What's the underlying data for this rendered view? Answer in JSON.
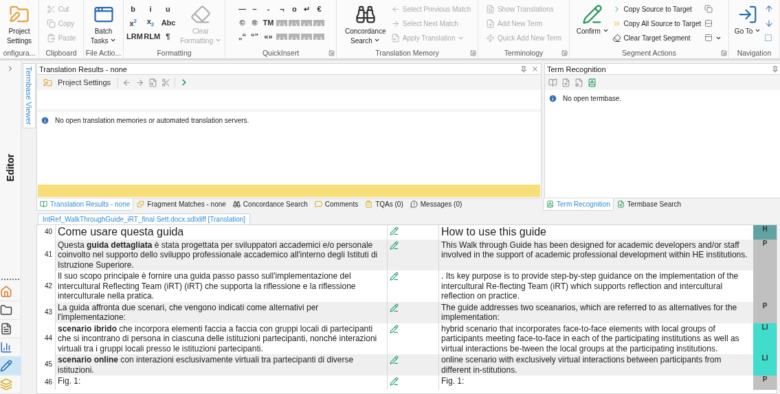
{
  "ribbon": {
    "groups": [
      {
        "label": "onfigura...",
        "launcher": false,
        "items": [
          {
            "kind": "large",
            "label": "Project Settings",
            "disabled": false,
            "dropdown": false
          }
        ]
      },
      {
        "label": "Clipboard",
        "launcher": false,
        "items": [
          {
            "kind": "small",
            "label": "Cut",
            "disabled": true,
            "dropdown": false
          },
          {
            "kind": "small",
            "label": "Copy",
            "disabled": true,
            "dropdown": false
          },
          {
            "kind": "small",
            "label": "Paste",
            "disabled": true,
            "dropdown": false
          }
        ]
      },
      {
        "label": "File Actio...",
        "launcher": false,
        "items": [
          {
            "kind": "large",
            "label": "Batch Tasks",
            "disabled": false,
            "dropdown": true
          }
        ]
      },
      {
        "label": "Formatting",
        "launcher": false,
        "items": [
          {
            "kind": "glyph",
            "label": "b"
          },
          {
            "kind": "glyph",
            "label": "i"
          },
          {
            "kind": "glyph",
            "label": "u"
          },
          {
            "kind": "glyph",
            "label": "x$^{2}$"
          },
          {
            "kind": "glyph",
            "label": "x$_{2}$"
          },
          {
            "kind": "glyph",
            "label": "Abc"
          },
          {
            "kind": "glyph",
            "label": "LRM"
          },
          {
            "kind": "glyph",
            "label": "RLM"
          },
          {
            "kind": "glyph",
            "label": "¶"
          },
          {
            "kind": "large",
            "label": "Clear Formatting",
            "disabled": true,
            "dropdown": true
          }
        ]
      },
      {
        "label": "QuickInsert",
        "launcher": true,
        "items": [
          {
            "kind": "glyph",
            "label": "—"
          },
          {
            "kind": "glyph",
            "label": "–"
          },
          {
            "kind": "glyph",
            "label": "-"
          },
          {
            "kind": "glyph",
            "label": "¬"
          },
          {
            "kind": "glyph",
            "label": "o"
          },
          {
            "kind": "glyph",
            "label": "↵"
          },
          {
            "kind": "glyph",
            "label": "€"
          },
          {
            "kind": "glyph",
            "label": "©"
          },
          {
            "kind": "glyph",
            "label": "®"
          },
          {
            "kind": "glyph",
            "label": "TM"
          },
          {
            "kind": "tag"
          },
          {
            "kind": "tag"
          },
          {
            "kind": "tag"
          },
          {
            "kind": "tag"
          },
          {
            "kind": "glyph",
            "label": "„“"
          },
          {
            "kind": "glyph",
            "label": "“”"
          },
          {
            "kind": "glyph",
            "label": "«»"
          },
          {
            "kind": "tag"
          },
          {
            "kind": "tag"
          },
          {
            "kind": "tag"
          },
          {
            "kind": "tag"
          }
        ]
      },
      {
        "label": "Translation Memory",
        "launcher": true,
        "items": [
          {
            "kind": "large",
            "label": "Concordance Search",
            "disabled": false,
            "dropdown": true
          },
          {
            "kind": "small",
            "label": "Select Previous Match",
            "disabled": true,
            "dropdown": false
          },
          {
            "kind": "small",
            "label": "Select Next Match",
            "disabled": true,
            "dropdown": false
          },
          {
            "kind": "small",
            "label": "Apply Translation",
            "disabled": true,
            "dropdown": true
          }
        ]
      },
      {
        "label": "Terminology",
        "launcher": true,
        "items": [
          {
            "kind": "small",
            "label": "Show Translations",
            "disabled": true,
            "dropdown": false
          },
          {
            "kind": "small",
            "label": "Add New Term",
            "disabled": true,
            "dropdown": false
          },
          {
            "kind": "small",
            "label": "Quick Add New Term",
            "disabled": true,
            "dropdown": false
          }
        ]
      },
      {
        "label": "Segment Actions",
        "launcher": true,
        "items": [
          {
            "kind": "large",
            "label": "Confirm",
            "disabled": false,
            "dropdown": true
          },
          {
            "kind": "small",
            "label": "Copy Source to Target",
            "disabled": false,
            "dropdown": false
          },
          {
            "kind": "small",
            "label": "Copy All Source to Target",
            "disabled": false,
            "dropdown": false
          },
          {
            "kind": "small",
            "label": "Clear Target Segment",
            "disabled": false,
            "dropdown": false
          },
          {
            "kind": "icon",
            "disabled": false,
            "dropdown": false
          },
          {
            "kind": "icon",
            "disabled": false,
            "dropdown": false
          },
          {
            "kind": "icon",
            "disabled": false,
            "dropdown": true
          }
        ]
      },
      {
        "label": "Navigation",
        "launcher": false,
        "items": [
          {
            "kind": "large",
            "label": "Go To",
            "disabled": false,
            "dropdown": true
          },
          {
            "kind": "icon",
            "disabled": false,
            "dropdown": false
          },
          {
            "kind": "icon",
            "disabled": false,
            "dropdown": false
          },
          {
            "kind": "icon",
            "disabled": false,
            "dropdown": false
          }
        ]
      }
    ]
  },
  "side_strip": {
    "label": "Editor",
    "nav": [
      {
        "selected": false
      },
      {
        "selected": false
      },
      {
        "selected": false
      },
      {
        "selected": false
      },
      {
        "selected": true
      },
      {
        "selected": false
      }
    ]
  },
  "termbase_viewer_tab": {
    "label": "Termbase Viewer"
  },
  "translation_results": {
    "title": "Translation Results - none",
    "toolbar_button": "Project Settings",
    "message": "No open translation memories or automated translation servers."
  },
  "term_recognition": {
    "title": "Term Recognition",
    "message": "No open termbase."
  },
  "left_tabs": [
    {
      "label": "Translation Results - none",
      "selected": true
    },
    {
      "label": "Fragment Matches - none",
      "selected": false
    },
    {
      "label": "Concordance Search",
      "selected": false
    },
    {
      "label": "Comments",
      "selected": false
    },
    {
      "label": "TQAs (0)",
      "selected": false
    },
    {
      "label": "Messages (0)",
      "selected": false
    }
  ],
  "right_tabs": [
    {
      "label": "Term Recognition",
      "selected": true
    },
    {
      "label": "Termbase Search",
      "selected": false
    }
  ],
  "document_tab": {
    "label": "IntRef_WalkThroughGuide_iRT_final Sett.docx.sdlxliff [Translation]"
  },
  "segments": [
    {
      "number": "40",
      "kind": "heading",
      "source": "Come usare questa guida",
      "target": "How to use this guide",
      "tag": "H",
      "color": "#5fa3a3"
    },
    {
      "number": "41",
      "kind": "text",
      "source": "Questa **guida dettagliata** è stata progettata per sviluppatori accademici e/o personale coinvolto nel supporto dello sviluppo professionale accademico all'interno degli Istituti di Istruzione Superiore.",
      "target": "This Walk through Guide has been designed for academic developers and/or staff involved in the support of academic professional development within HE institutions.",
      "tag": "P",
      "color": "#c0c0c0"
    },
    {
      "number": "42",
      "kind": "text",
      "source": "Il suo scopo principale è fornire una guida passo passo sull'implementazione del intercultural Reflecting Team (iRT) (iRT) che supporta la riflessione e la riflessione interculturale nella pratica.",
      "target": ". Its key purpose is to provide step-by-step guidance on the implementation of the intercultural Re-flecting Team (iRT) which supports reflection and intercultural reflection on practice.",
      "color": "#c0c0c0"
    },
    {
      "number": "43",
      "kind": "text",
      "source": "La guida affronta due scenari, che vengono indicati come alternativi per l'implementazione:",
      "target": "The guide addresses two sceanarios, which are referred to as alternatives for the implementation:",
      "tag": "P",
      "color": "#c0c0c0"
    },
    {
      "number": "44",
      "kind": "text",
      "source": "**scenario ibrido** che incorpora elementi faccia a faccia con gruppi locali di partecipanti che si incontrano di persona in ciascuna delle istituzioni partecipanti, nonché interazioni virtuali tra i gruppi locali presso le istituzioni partecipanti.",
      "target": "hybrid scenario that incorporates face-to-face elements with local groups of participants meeting face-to-face in each of the participating institutions as well as virtual interactions be-tween the local groups at the participating institutions.",
      "tag": "LI",
      "color": "#40dccc"
    },
    {
      "number": "45",
      "kind": "text",
      "source": "**scenario online** con interazioni esclusivamente virtuali tra partecipanti di diverse istituzioni.",
      "target": "online scenario with exclusively virtual interactions between participants from different in-stitutions.",
      "tag": "LI",
      "color": "#40dccc"
    },
    {
      "number": "46",
      "kind": "text",
      "source": "Fig. 1:",
      "target": "Fig. 1:",
      "tag": "P",
      "color": "#c0c0c0"
    }
  ]
}
